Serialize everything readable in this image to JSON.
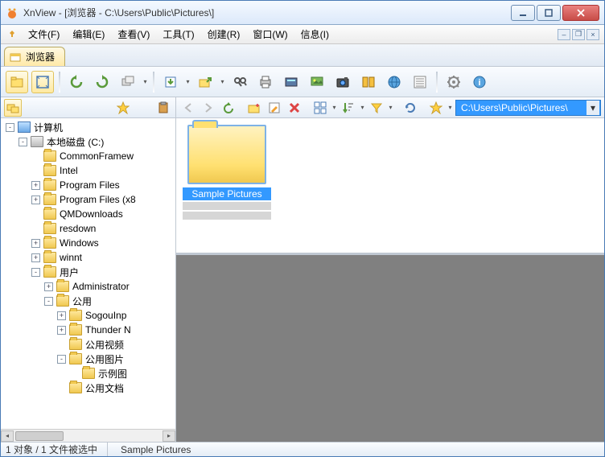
{
  "title": "XnView - [浏览器 - C:\\Users\\Public\\Pictures\\]",
  "menu": {
    "file": "文件(F)",
    "edit": "编辑(E)",
    "view": "查看(V)",
    "tools": "工具(T)",
    "create": "创建(R)",
    "window": "窗口(W)",
    "info": "信息(I)"
  },
  "tab": {
    "label": "浏览器"
  },
  "path": "C:\\Users\\Public\\Pictures\\",
  "tree": [
    {
      "depth": 0,
      "exp": "-",
      "icon": "computer",
      "label": "计算机"
    },
    {
      "depth": 1,
      "exp": "-",
      "icon": "drive",
      "label": "本地磁盘 (C:)"
    },
    {
      "depth": 2,
      "exp": " ",
      "icon": "folder",
      "label": "CommonFramew"
    },
    {
      "depth": 2,
      "exp": " ",
      "icon": "folder",
      "label": "Intel"
    },
    {
      "depth": 2,
      "exp": "+",
      "icon": "folder",
      "label": "Program Files"
    },
    {
      "depth": 2,
      "exp": "+",
      "icon": "folder",
      "label": "Program Files (x8"
    },
    {
      "depth": 2,
      "exp": " ",
      "icon": "folder",
      "label": "QMDownloads"
    },
    {
      "depth": 2,
      "exp": " ",
      "icon": "folder",
      "label": "resdown"
    },
    {
      "depth": 2,
      "exp": "+",
      "icon": "folder",
      "label": "Windows"
    },
    {
      "depth": 2,
      "exp": "+",
      "icon": "folder",
      "label": "winnt"
    },
    {
      "depth": 2,
      "exp": "-",
      "icon": "folder",
      "label": "用户"
    },
    {
      "depth": 3,
      "exp": "+",
      "icon": "folder",
      "label": "Administrator"
    },
    {
      "depth": 3,
      "exp": "-",
      "icon": "folder",
      "label": "公用"
    },
    {
      "depth": 4,
      "exp": "+",
      "icon": "folder",
      "label": "SogouInp"
    },
    {
      "depth": 4,
      "exp": "+",
      "icon": "folder",
      "label": "Thunder N"
    },
    {
      "depth": 4,
      "exp": " ",
      "icon": "folder",
      "label": "公用视频"
    },
    {
      "depth": 4,
      "exp": "-",
      "icon": "folder",
      "label": "公用图片"
    },
    {
      "depth": 5,
      "exp": " ",
      "icon": "folder",
      "label": "示例图"
    },
    {
      "depth": 4,
      "exp": " ",
      "icon": "folder",
      "label": "公用文档"
    }
  ],
  "thumb": {
    "label": "Sample Pictures"
  },
  "status": {
    "count": "1 对象 / 1 文件被选中",
    "name": "Sample Pictures"
  }
}
